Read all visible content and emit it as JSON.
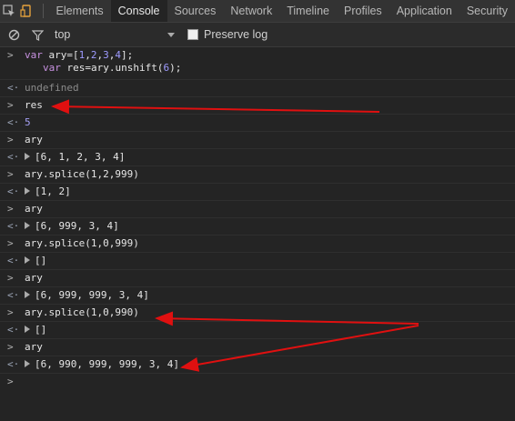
{
  "tabs": [
    {
      "label": "Elements"
    },
    {
      "label": "Console"
    },
    {
      "label": "Sources"
    },
    {
      "label": "Network"
    },
    {
      "label": "Timeline"
    },
    {
      "label": "Profiles"
    },
    {
      "label": "Application"
    },
    {
      "label": "Security"
    }
  ],
  "filter": {
    "context": "top",
    "preserve_log_label": "Preserve log"
  },
  "console": [
    {
      "kind": "input",
      "code_line1": "var ary=[1,2,3,4];",
      "code_line2": "var res=ary.unshift(6);"
    },
    {
      "kind": "output",
      "text": "undefined"
    },
    {
      "kind": "input",
      "text": "res"
    },
    {
      "kind": "output",
      "text": "5"
    },
    {
      "kind": "input",
      "text": "ary"
    },
    {
      "kind": "output",
      "text": "[6, 1, 2, 3, 4]"
    },
    {
      "kind": "input",
      "text": "ary.splice(1,2,999)"
    },
    {
      "kind": "output",
      "text": "[1, 2]"
    },
    {
      "kind": "input",
      "text": "ary"
    },
    {
      "kind": "output",
      "text": "[6, 999, 3, 4]"
    },
    {
      "kind": "input",
      "text": "ary.splice(1,0,999)"
    },
    {
      "kind": "output",
      "text": "[]"
    },
    {
      "kind": "input",
      "text": "ary"
    },
    {
      "kind": "output",
      "text": "[6, 999, 999, 3, 4]"
    },
    {
      "kind": "input",
      "text": "ary.splice(1,0,990)"
    },
    {
      "kind": "output",
      "text": "[]"
    },
    {
      "kind": "input",
      "text": "ary"
    },
    {
      "kind": "output",
      "text": "[6, 990, 999, 999, 3, 4]"
    }
  ],
  "colors": {
    "annotation_arrow": "#e01010",
    "background": "#242424"
  }
}
